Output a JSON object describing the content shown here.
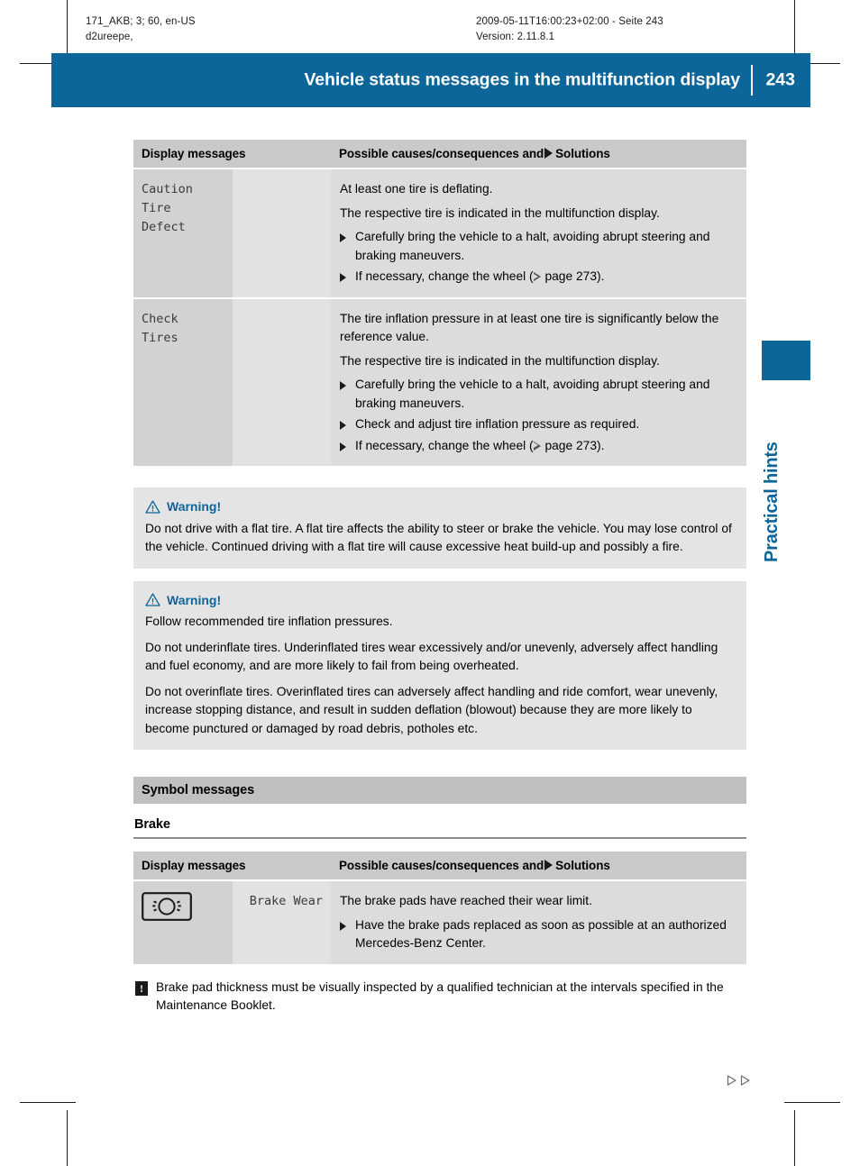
{
  "meta": {
    "left_line1": "171_AKB; 3; 60, en-US",
    "left_line2": "d2ureepe,",
    "right_line1": "2009-05-11T16:00:23+02:00 - Seite 243",
    "right_line2": "Version: 2.11.8.1"
  },
  "header": {
    "title": "Vehicle status messages in the multifunction display",
    "page_number": "243",
    "accent_color": "#0d6699"
  },
  "side_tab": {
    "label": "Practical hints"
  },
  "table_headers": {
    "col1": "Display messages",
    "col2_prefix": "Possible causes/consequences and",
    "col2_suffix": "Solutions"
  },
  "status_table": {
    "rows": [
      {
        "message": "Caution\nTire\nDefect",
        "paragraphs": [
          "At least one tire is deflating.",
          "The respective tire is indicated in the multifunction display."
        ],
        "bullets": [
          {
            "text": "Carefully bring the vehicle to a halt, avoiding abrupt steering and braking maneuvers."
          },
          {
            "text_before": "If necessary, change the wheel (",
            "page_ref": "page 273",
            "text_after": ")."
          }
        ]
      },
      {
        "message": "Check\nTires",
        "paragraphs": [
          "The tire inflation pressure in at least one tire is significantly below the reference value.",
          "The respective tire is indicated in the multifunction display."
        ],
        "bullets": [
          {
            "text": "Carefully bring the vehicle to a halt, avoiding abrupt steering and braking maneuvers."
          },
          {
            "text": "Check and adjust tire inflation pressure as required."
          },
          {
            "text_before": "If necessary, change the wheel (",
            "page_ref": "page 273",
            "text_after": ")."
          }
        ]
      }
    ]
  },
  "warnings": [
    {
      "title": "Warning!",
      "paragraphs": [
        "Do not drive with a flat tire. A flat tire affects the ability to steer or brake the vehicle. You may lose control of the vehicle. Continued driving with a flat tire will cause excessive heat build-up and possibly a fire."
      ]
    },
    {
      "title": "Warning!",
      "paragraphs": [
        "Follow recommended tire inflation pressures.",
        "Do not underinflate tires. Underinflated tires wear excessively and/or unevenly, adversely affect handling and fuel economy, and are more likely to fail from being overheated.",
        "Do not overinflate tires. Overinflated tires can adversely affect handling and ride comfort, wear unevenly, increase stopping distance, and result in sudden deflation (blowout) because they are more likely to become punctured or damaged by road debris, potholes etc."
      ]
    }
  ],
  "symbol_section": {
    "bar_label": "Symbol messages",
    "subheading": "Brake",
    "row": {
      "icon_name": "brake-wear-indicator-icon",
      "message": "Brake Wear",
      "paragraphs": [
        "The brake pads have reached their wear limit."
      ],
      "bullets": [
        {
          "text": "Have the brake pads replaced as soon as possible at an authorized Mercedes-Benz Center."
        }
      ]
    }
  },
  "note": {
    "icon": "!",
    "text": "Brake pad thickness must be visually inspected by a qualified technician at the intervals specified in the Maintenance Booklet."
  }
}
